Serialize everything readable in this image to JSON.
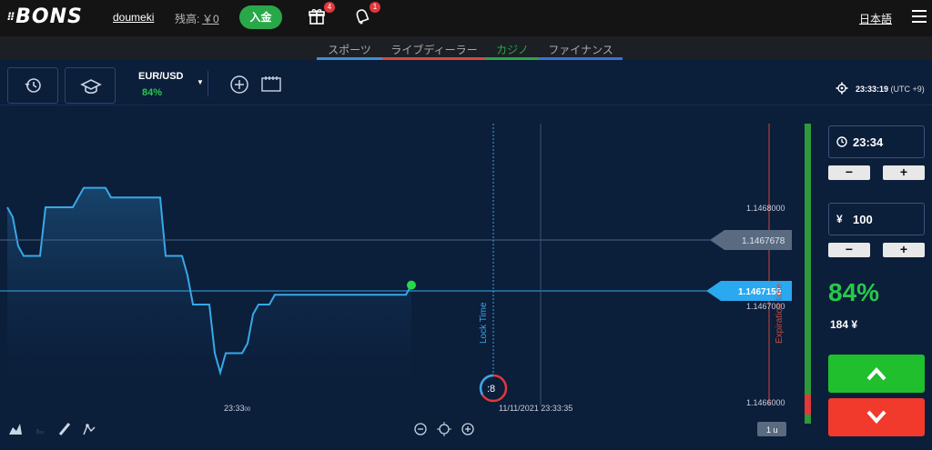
{
  "header": {
    "logo": "BONS",
    "username": "doumeki",
    "balance_label": "残高:",
    "balance_value": "￥0",
    "deposit_label": "入金",
    "gift_badge": "4",
    "notify_badge": "1",
    "language": "日本語"
  },
  "nav": {
    "tabs": [
      {
        "label": "スポーツ",
        "color": "#3d8fd6"
      },
      {
        "label": "ライブディーラー",
        "color": "#d64a3d"
      },
      {
        "label": "カジノ",
        "color": "#2aa84a"
      },
      {
        "label": "ファイナンス",
        "color": "#3d6fd6"
      }
    ],
    "active_tab": "カジノ"
  },
  "toolbar": {
    "asset": "EUR/USD",
    "asset_payout": "84%",
    "clock": "23:33:19",
    "timezone": "(UTC +9)"
  },
  "chart": {
    "price_ticks": [
      "1.1468000",
      "1.1467000",
      "1.1466000"
    ],
    "prev_price_tag": "1.1467678",
    "current_price_tag": "1.1467150",
    "time_tick": "23:33",
    "time_tick_seconds": "00",
    "lock_time_label": "Lock Time",
    "expiration_label": "Expiration time",
    "countdown": ":8",
    "crosshair_time": "11/11/2021 23:33:35",
    "interval_button": "1 u",
    "line_color": "#38a8e8",
    "zoom_out_icon": "zoom-out-icon",
    "zoom_reset_icon": "crosshair-icon",
    "zoom_in_icon": "zoom-in-icon"
  },
  "chart_data": {
    "type": "area",
    "series": [
      {
        "x": [
          0,
          6,
          12,
          18,
          24,
          30,
          36,
          42,
          48,
          54,
          60,
          66,
          72,
          78,
          84,
          90,
          96,
          102,
          108,
          114,
          120,
          126,
          132,
          138,
          144,
          150,
          156,
          162,
          168,
          174,
          180,
          186,
          192,
          198,
          204,
          210,
          216,
          222,
          228,
          234,
          240,
          246,
          252,
          258,
          264,
          270,
          276,
          282,
          288,
          294,
          300,
          306,
          312,
          318,
          324,
          330,
          336,
          342,
          348,
          354,
          360,
          366,
          372,
          378,
          384,
          390,
          396,
          402,
          408,
          414,
          420,
          426,
          432,
          438,
          444
        ],
        "values": [
          1.1468,
          1.14679,
          1.14676,
          1.14675,
          1.14675,
          1.14675,
          1.14675,
          1.1468,
          1.1468,
          1.1468,
          1.1468,
          1.1468,
          1.1468,
          1.14681,
          1.14682,
          1.14682,
          1.14682,
          1.14682,
          1.14682,
          1.14681,
          1.14681,
          1.14681,
          1.14681,
          1.14681,
          1.14681,
          1.14681,
          1.14681,
          1.14681,
          1.14681,
          1.14675,
          1.14675,
          1.14675,
          1.14675,
          1.14673,
          1.1467,
          1.1467,
          1.1467,
          1.1467,
          1.14665,
          1.14663,
          1.14665,
          1.14665,
          1.14665,
          1.14665,
          1.14666,
          1.14669,
          1.1467,
          1.1467,
          1.1467,
          1.14671,
          1.14671,
          1.14671,
          1.14671,
          1.14671,
          1.14671,
          1.14671,
          1.14671,
          1.14671,
          1.14671,
          1.14671,
          1.14671,
          1.14671,
          1.14671,
          1.14671,
          1.14671,
          1.14671,
          1.14671,
          1.14671,
          1.14671,
          1.14671,
          1.14671,
          1.14671,
          1.14671,
          1.14671,
          1.14672
        ]
      }
    ],
    "ylim": [
      1.1466,
      1.1468
    ],
    "grid": false
  },
  "side": {
    "expiry_time": "23:34",
    "investment": "100",
    "currency": "¥",
    "payout_pct": "84%",
    "payout_amount": "184 ¥",
    "minus": "−",
    "plus": "+"
  }
}
